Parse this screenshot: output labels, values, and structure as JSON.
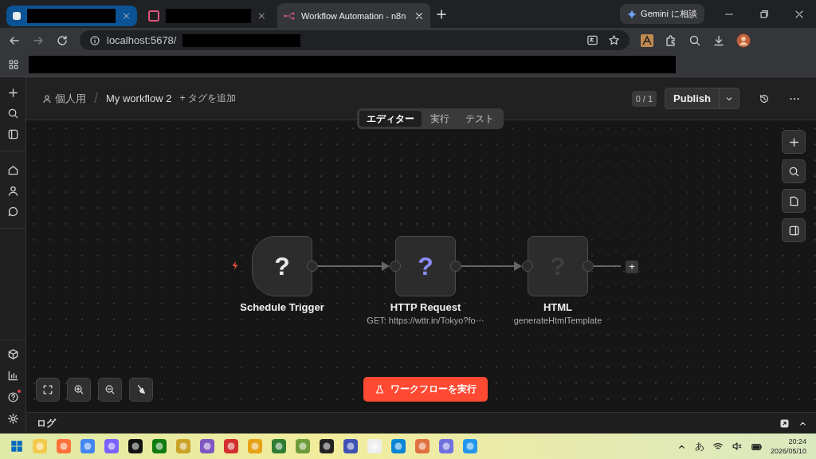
{
  "browser": {
    "tabs": [
      {
        "selected": false,
        "kind": "redacted"
      },
      {
        "selected": false,
        "kind": "redacted"
      },
      {
        "title": "Workflow Automation - n8n",
        "selected": true,
        "kind": "page"
      }
    ],
    "gemini_button": "Gemini に相談",
    "address": "localhost:5678/"
  },
  "header": {
    "project": "個人用",
    "separator": "/",
    "workflow": "My workflow 2",
    "add_tag": "+ タグを追加",
    "counter": "0 / 1",
    "publish": "Publish"
  },
  "mode_tabs": [
    {
      "label": "エディター",
      "selected": true
    },
    {
      "label": "実行",
      "selected": false
    },
    {
      "label": "テスト",
      "selected": false
    }
  ],
  "nodes": [
    {
      "name": "Schedule Trigger",
      "kind": "trigger",
      "icon": "?",
      "color": "#e8e8e8"
    },
    {
      "name": "HTTP Request",
      "subtitle": "GET: https://wttr.in/Tokyo?fo···",
      "kind": "action",
      "icon": "?",
      "color": "#8b8cf7"
    },
    {
      "name": "HTML",
      "subtitle": "generateHtmlTemplate",
      "kind": "action",
      "icon": "?",
      "color": "#3f3f3f"
    }
  ],
  "add_node": "+",
  "run_button": "ワークフローを実行",
  "log_panel": {
    "title": "ログ"
  },
  "taskbar": {
    "ime": "あ",
    "time": "20:24",
    "date": "2026/05/10"
  }
}
